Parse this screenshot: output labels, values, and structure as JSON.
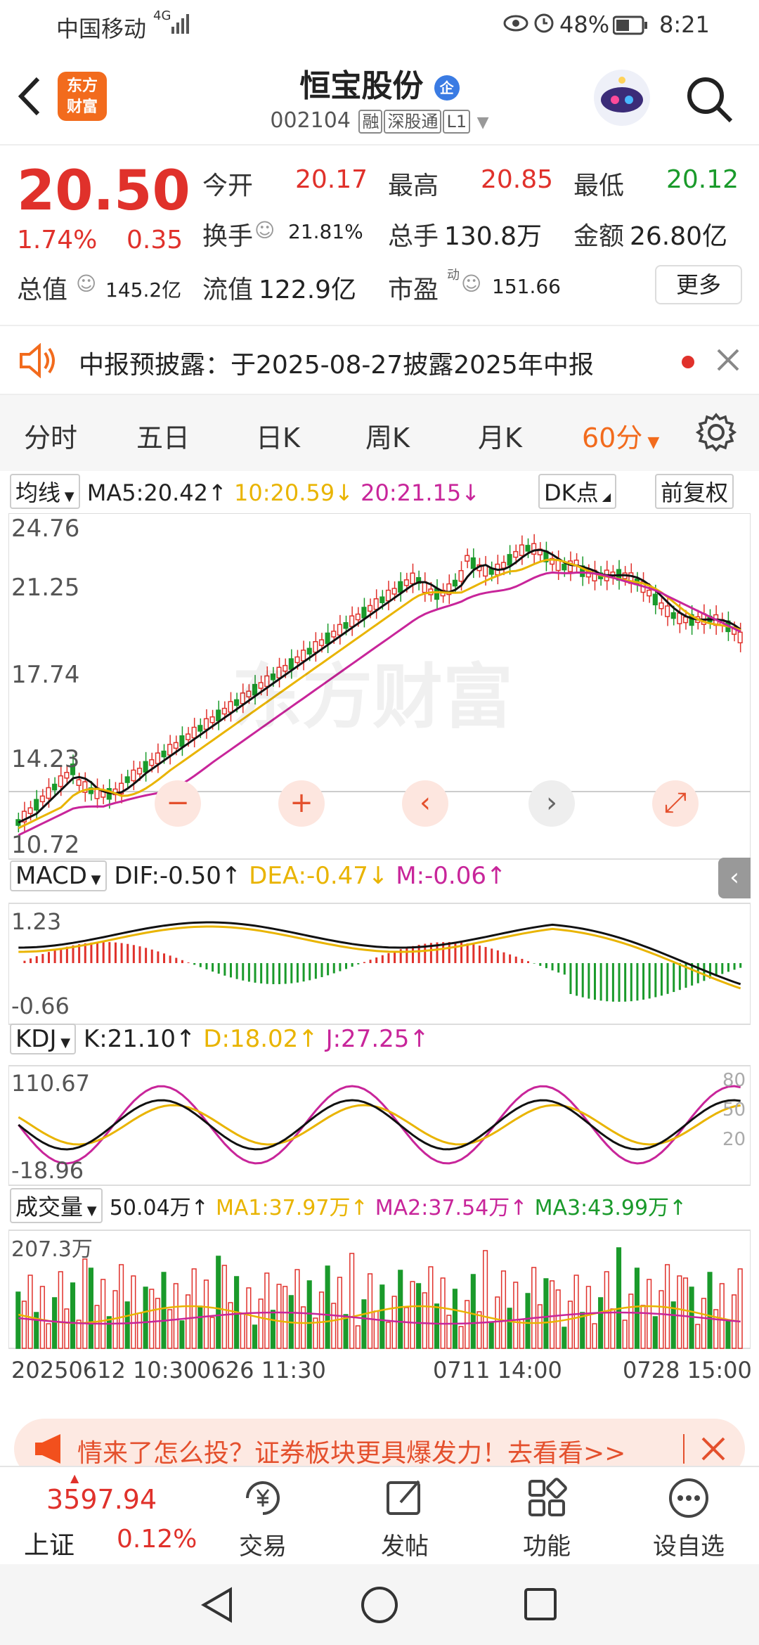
{
  "status": {
    "carrier": "中国移动",
    "signal": "4G",
    "battery": "48%",
    "time": "8:21"
  },
  "header": {
    "logo_line1": "东方",
    "logo_line2": "财富",
    "title": "恒宝股份",
    "title_badge": "企",
    "code": "002104",
    "tags": [
      "融",
      "深股通",
      "L1"
    ]
  },
  "quote": {
    "price": "20.50",
    "change_pct": "1.74%",
    "change_amt": "0.35",
    "open_label": "今开",
    "open": "20.17",
    "high_label": "最高",
    "high": "20.85",
    "low_label": "最低",
    "low": "20.12",
    "turnover_label": "换手",
    "turnover": "21.81%",
    "volume_label": "总手",
    "volume": "130.8万",
    "amount_label": "金额",
    "amount": "26.80亿",
    "mcap_label": "总值",
    "mcap": "145.2亿",
    "float_label": "流值",
    "float": "122.9亿",
    "pe_label": "市盈",
    "pe_sup": "动",
    "pe": "151.66",
    "more_label": "更多"
  },
  "notice": {
    "text": "中报预披露：于2025-08-27披露2025年中报"
  },
  "tabs": [
    "分时",
    "五日",
    "日K",
    "周K",
    "月K",
    "60分"
  ],
  "chart": {
    "ma_label": "均线",
    "ma5": "MA5:20.42↑",
    "ma10": "10:20.59↓",
    "ma20": "20:21.15↓",
    "dk_label": "DK点",
    "adjust_label": "前复权",
    "price_ticks": [
      "24.76",
      "21.25",
      "17.74",
      "14.23",
      "10.72"
    ],
    "watermark": "东方财富",
    "macd_label": "MACD",
    "dif": "DIF:-0.50↑",
    "dea": "DEA:-0.47↓",
    "m": "M:-0.06↑",
    "macd_ticks": [
      "1.23",
      "-0.66"
    ],
    "kdj_label": "KDJ",
    "k": "K:21.10↑",
    "d": "D:18.02↑",
    "j": "J:27.25↑",
    "kdj_ticks": [
      "110.67",
      "-18.96"
    ],
    "kdj_right_ticks": [
      "80",
      "50",
      "20"
    ],
    "vol_label": "成交量",
    "vol": "50.04万↑",
    "vol_ma1": "MA1:37.97万↑",
    "vol_ma2": "MA2:37.54万↑",
    "vol_ma3": "MA3:43.99万↑",
    "vol_tick": "207.3万",
    "time_ticks": [
      "20250612 10:30",
      "0626 11:30",
      "0711 14:00",
      "0728 15:00"
    ]
  },
  "promo": {
    "text": "情来了怎么投？证券板块更具爆发力！去看看>>"
  },
  "bottom_nav": {
    "index_value": "3597.94",
    "index_name": "上证",
    "index_pct": "0.12%",
    "items": [
      "交易",
      "发帖",
      "功能",
      "设自选"
    ]
  },
  "colors": {
    "up": "#e0312b",
    "down": "#1a9a2b",
    "accent": "#f26b1d",
    "ma10": "#e9b400",
    "ma20": "#c8259a"
  }
}
